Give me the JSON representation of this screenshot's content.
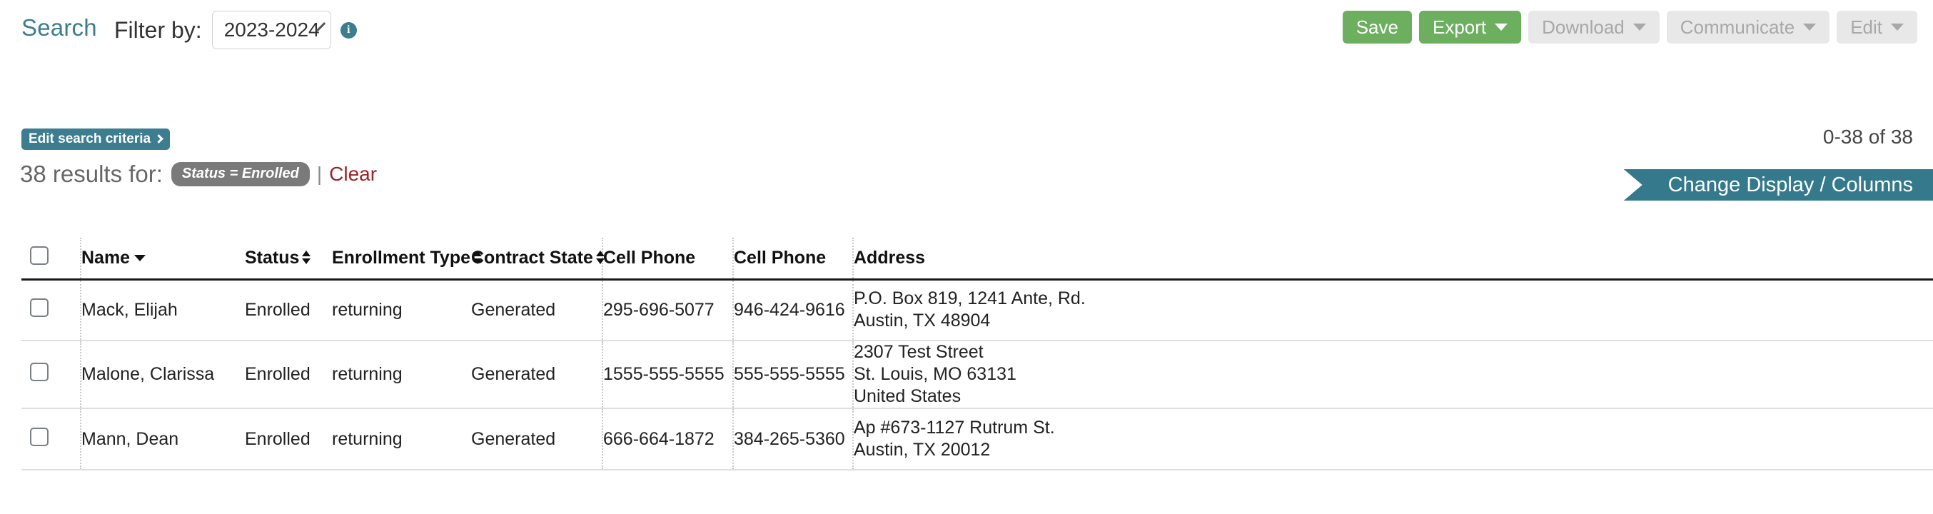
{
  "header": {
    "search_link": "Search",
    "filter_label": "Filter by:",
    "filter_value": "2023-2024",
    "info_icon": "info-icon",
    "chevron_icon": "chevron-down-icon"
  },
  "actions": [
    {
      "label": "Save",
      "style": "green",
      "caret": false,
      "disabled": false
    },
    {
      "label": "Export",
      "style": "green",
      "caret": true,
      "disabled": false
    },
    {
      "label": "Download",
      "style": "grey",
      "caret": true,
      "disabled": true
    },
    {
      "label": "Communicate",
      "style": "grey",
      "caret": true,
      "disabled": true
    },
    {
      "label": "Edit",
      "style": "grey",
      "caret": true,
      "disabled": true
    }
  ],
  "criteria": {
    "edit_button": "Edit search criteria",
    "results_text": "38 results for:",
    "filter_pill": "Status = Enrolled",
    "separator": "|",
    "clear_label": "Clear"
  },
  "pagination": {
    "range_text": "0-38 of 38"
  },
  "change_display": {
    "label": "Change Display / Columns"
  },
  "colors": {
    "teal": "#3c7d8f",
    "teal_banner": "#35798c",
    "green": "#6cb05f",
    "grey_button": "#e8e8e8",
    "grey_button_text": "#a8a8a8",
    "pill_grey": "#7a7a7a",
    "clear_red": "#9b2226"
  },
  "table": {
    "columns": [
      {
        "key": "checkbox",
        "label": "",
        "sort": "none",
        "divider": false
      },
      {
        "key": "name",
        "label": "Name",
        "sort": "desc",
        "divider": true
      },
      {
        "key": "status",
        "label": "Status",
        "sort": "both",
        "divider": false
      },
      {
        "key": "enroll",
        "label": "Enrollment Type",
        "sort": "both",
        "divider": false
      },
      {
        "key": "cstate",
        "label": "Contract State",
        "sort": "both",
        "divider": false
      },
      {
        "key": "phone1",
        "label": "Cell Phone",
        "sort": "none",
        "divider": true
      },
      {
        "key": "phone2",
        "label": "Cell Phone",
        "sort": "none",
        "divider": true
      },
      {
        "key": "address",
        "label": "Address",
        "sort": "none",
        "divider": true
      }
    ],
    "rows": [
      {
        "name": "Mack, Elijah",
        "status": "Enrolled",
        "enroll": "returning",
        "cstate": "Generated",
        "phone1": "295-696-5077",
        "phone2": "946-424-9616",
        "address": [
          "P.O. Box 819, 1241 Ante, Rd.",
          "Austin, TX 48904"
        ]
      },
      {
        "name": "Malone, Clarissa",
        "status": "Enrolled",
        "enroll": "returning",
        "cstate": "Generated",
        "phone1": "1555-555-5555",
        "phone2": "555-555-5555",
        "address": [
          "2307 Test Street",
          "St. Louis, MO 63131",
          "United States"
        ]
      },
      {
        "name": "Mann, Dean",
        "status": "Enrolled",
        "enroll": "returning",
        "cstate": "Generated",
        "phone1": "666-664-1872",
        "phone2": "384-265-5360",
        "address": [
          "Ap #673-1127 Rutrum St.",
          "Austin, TX 20012"
        ]
      }
    ]
  }
}
